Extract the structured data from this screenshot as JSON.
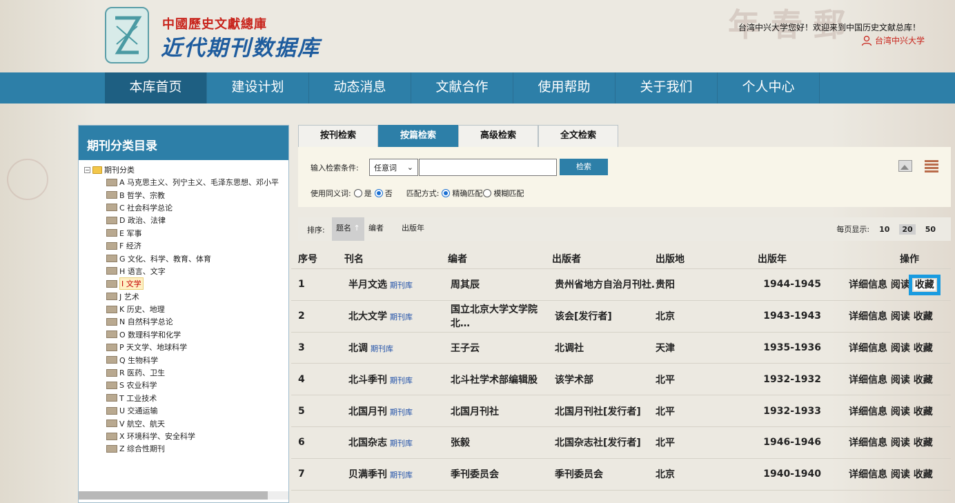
{
  "header": {
    "brand_sub": "中國歷史文獻總庫",
    "brand_main": "近代期刊数据库",
    "welcome": "台湾中兴大学您好！欢迎来到中国历史文献总库！",
    "user_name": "台湾中兴大学"
  },
  "nav": {
    "items": [
      "本库首页",
      "建设计划",
      "动态消息",
      "文献合作",
      "使用帮助",
      "关于我们",
      "个人中心"
    ],
    "active_index": 0
  },
  "sidebar": {
    "title": "期刊分类目录",
    "root": "期刊分类",
    "items": [
      "A 马克思主义、列宁主义、毛泽东思想、邓小平",
      "B 哲学、宗教",
      "C 社会科学总论",
      "D 政治、法律",
      "E 军事",
      "F 经济",
      "G 文化、科学、教育、体育",
      "H 语言、文字",
      "I 文学",
      "J 艺术",
      "K 历史、地理",
      "N 自然科学总论",
      "O 数理科学和化学",
      "P 天文学、地球科学",
      "Q 生物科学",
      "R 医药、卫生",
      "S 农业科学",
      "T 工业技术",
      "U 交通运输",
      "V 航空、航天",
      "X 环境科学、安全科学",
      "Z 综合性期刊"
    ],
    "selected_index": 8
  },
  "tabs": [
    "按刊检索",
    "按篇检索",
    "高级检索",
    "全文检索"
  ],
  "active_tab": 1,
  "search": {
    "label": "输入检索条件:",
    "select_value": "任意词",
    "input_value": "",
    "button": "检索",
    "synonym_label": "使用同义词:",
    "yes": "是",
    "no": "否",
    "match_label": "匹配方式:",
    "exact": "精确匹配",
    "fuzzy": "模糊匹配"
  },
  "sort": {
    "label": "排序:",
    "options": [
      "题名",
      "编者",
      "出版年"
    ],
    "active": "题名",
    "perpage_label": "每页显示:",
    "perpage": [
      "10",
      "20",
      "50"
    ],
    "perpage_active": "20"
  },
  "table": {
    "headers": [
      "序号",
      "刊名",
      "编者",
      "出版者",
      "出版地",
      "出版年",
      "操作"
    ],
    "tag": "期刊库",
    "ops": [
      "详细信息",
      "阅读",
      "收藏"
    ],
    "rows": [
      {
        "no": "1",
        "title": "半月文选",
        "editor": "周其辰",
        "publisher": "贵州省地方自治月刊社…",
        "place": "贵阳",
        "year": "1944-1945"
      },
      {
        "no": "2",
        "title": "北大文学",
        "editor": "国立北京大学文学院北…",
        "publisher": "该会[发行者]",
        "place": "北京",
        "year": "1943-1943"
      },
      {
        "no": "3",
        "title": "北调",
        "editor": "王子云",
        "publisher": "北调社",
        "place": "天津",
        "year": "1935-1936"
      },
      {
        "no": "4",
        "title": "北斗季刊",
        "editor": "北斗社学术部编辑股",
        "publisher": "该学术部",
        "place": "北平",
        "year": "1932-1932"
      },
      {
        "no": "5",
        "title": "北国月刊",
        "editor": "北国月刊社",
        "publisher": "北国月刊社[发行者]",
        "place": "北平",
        "year": "1932-1933"
      },
      {
        "no": "6",
        "title": "北国杂志",
        "editor": "张毅",
        "publisher": "北国杂志社[发行者]",
        "place": "北平",
        "year": "1946-1946"
      },
      {
        "no": "7",
        "title": "贝满季刊",
        "editor": "季刊委员会",
        "publisher": "季刊委员会",
        "place": "北京",
        "year": "1940-1940"
      }
    ]
  }
}
